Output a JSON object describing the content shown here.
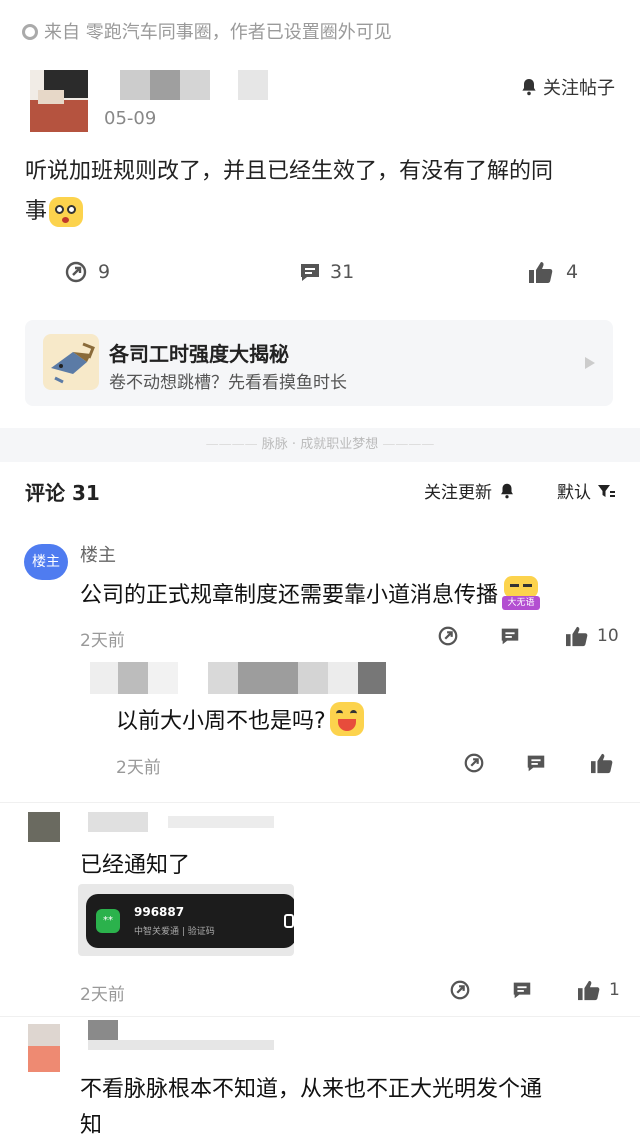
{
  "post": {
    "source": "来自 零跑汽车同事圈，作者已设置圈外可见",
    "date": "05-09",
    "follow_label": "关注帖子",
    "text_line1": "听说加班规则改了，并且已经生效了，有没有了解的同",
    "text_line2": "事",
    "stats": {
      "shares": "9",
      "comments": "31",
      "likes": "4"
    }
  },
  "promo": {
    "title": "各司工时强度大揭秘",
    "subtitle": "卷不动想跳槽？先看看摸鱼时长"
  },
  "separator": "脉脉 · 成就职业梦想",
  "comments_header": {
    "title": "评论 31",
    "follow_update": "关注更新",
    "sort": "默认"
  },
  "comments": [
    {
      "badge": "楼主",
      "name": "楼主",
      "text": "公司的正式规章制度还需要靠小道消息传播",
      "emoji_tag": "大无语",
      "time": "2天前",
      "likes": "10"
    },
    {
      "text": "以前大小周不也是吗?",
      "time": "2天前"
    },
    {
      "text": "已经通知了",
      "time": "2天前",
      "likes": "1",
      "image": {
        "number": "996887",
        "caption": "中智关爱通 | 验证码"
      }
    },
    {
      "text_line1": "不看脉脉根本不知道，从来也不正大光明发个通",
      "text_line2": "知"
    }
  ],
  "colors": {
    "accent": "#4f7cf0",
    "emoji": "#fcd34d",
    "bg_gray": "#f5f6f8"
  }
}
